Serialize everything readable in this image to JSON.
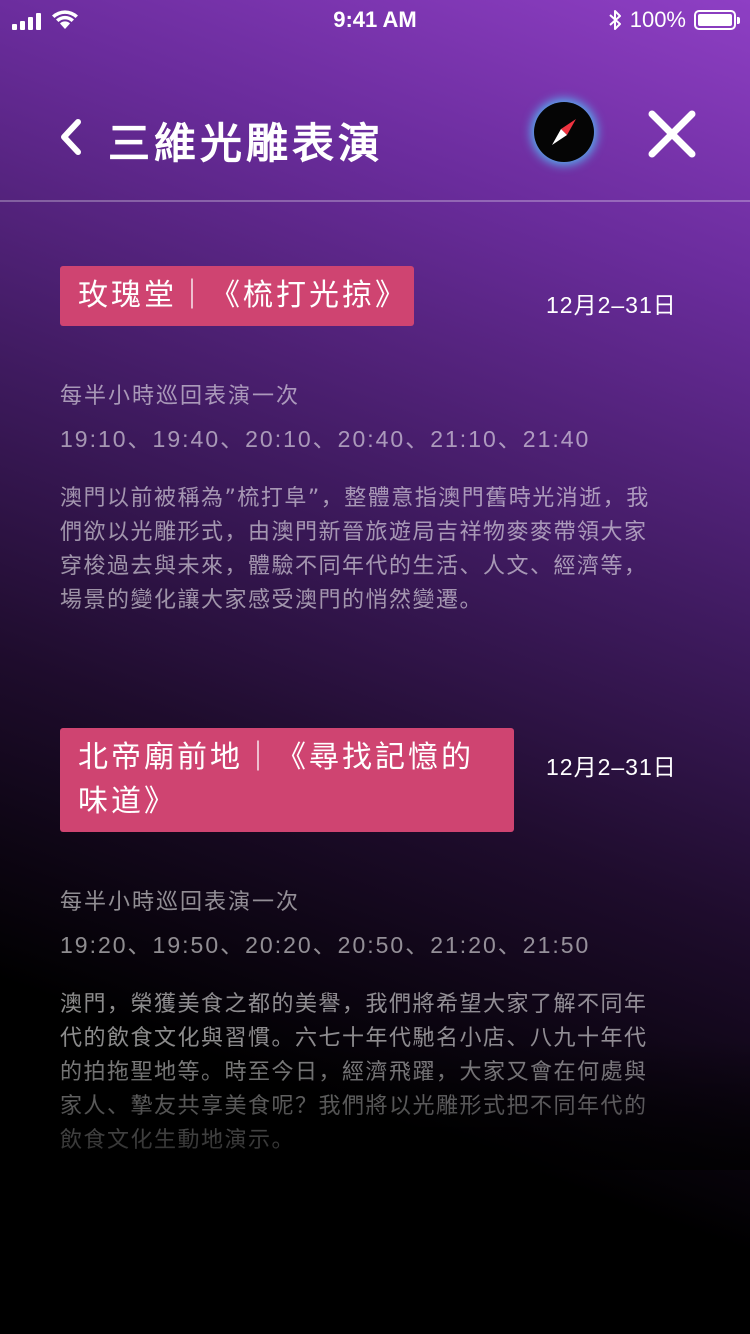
{
  "status_bar": {
    "time": "9:41 AM",
    "battery": "100%"
  },
  "nav": {
    "title": "三維光雕表演"
  },
  "events": [
    {
      "tag": "玫瑰堂｜《梳打光掠》",
      "date": "12月2–31日",
      "frequency": "每半小時巡回表演一次",
      "times": "19:10、19:40、20:10、20:40、21:10、21:40",
      "description": "澳門以前被稱為”梳打阜”，整體意指澳門舊時光消逝，我們欲以光雕形式，由澳門新晉旅遊局吉祥物麥麥帶領大家穿梭過去與未來，體驗不同年代的生活、人文、經濟等，場景的變化讓大家感受澳門的悄然變遷。"
    },
    {
      "tag": "北帝廟前地｜《尋找記憶的味道》",
      "date": "12月2–31日",
      "frequency": "每半小時巡回表演一次",
      "times": "19:20、19:50、20:20、20:50、21:20、21:50",
      "description": "澳門，榮獲美食之都的美譽，我們將希望大家了解不同年代的飲食文化與習慣。六七十年代馳名小店、八九十年代的拍拖聖地等。時至今日，經濟飛躍，大家又會在何處與家人、摯友共享美食呢？我們將以光雕形式把不同年代的飲食文化生動地演示。"
    }
  ],
  "icons": {
    "back": "chevron-left-icon",
    "compass": "compass-icon",
    "close": "close-icon",
    "signal": "signal-icon",
    "wifi": "wifi-icon",
    "bluetooth": "bluetooth-icon",
    "battery": "battery-icon"
  },
  "colors": {
    "accent_tag": "#cf4471",
    "compass_glow": "#50c8ff",
    "compass_needle": "#ef3340",
    "background_top": "#8e3fc4",
    "background_bottom": "#000000"
  }
}
